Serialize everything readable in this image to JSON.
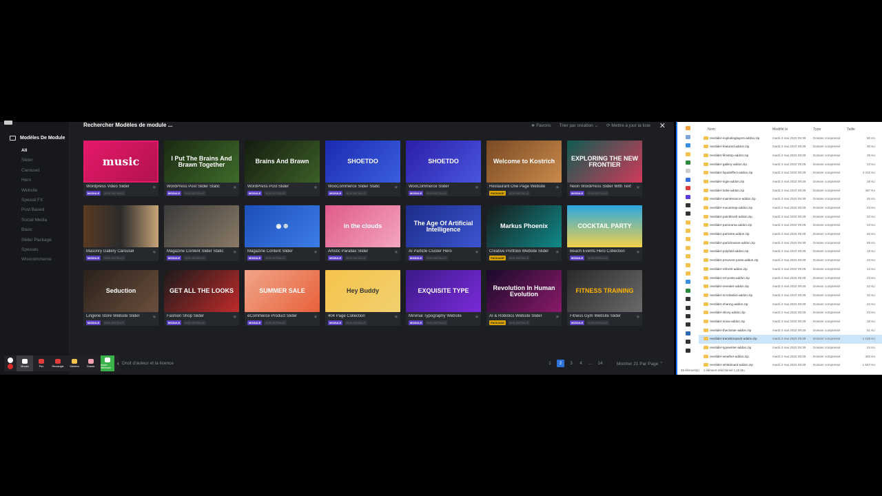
{
  "app": {
    "sidebar_title": "Modèles De Module",
    "categories": [
      "All",
      "Slider",
      "Carousel",
      "Hero",
      "Website",
      "Special FX",
      "Post Based",
      "Social Media",
      "Basic",
      "Slider Package",
      "Specials",
      "Woocommerce"
    ],
    "active_category": "All",
    "search_title": "Rechercher Modèles de module ...",
    "actions": {
      "favorites": "★ Favoris",
      "sort": "Trier par création ⌄",
      "update": "⟳ Mettre à jour la liste"
    },
    "close": "✕",
    "tags": {
      "module": "MODULE",
      "package": "PACKAGE",
      "not_installed": "NON INSTALLÉ"
    },
    "cards": [
      {
        "name": "Wordpress Video Slider",
        "thumb": "music",
        "bg": "linear-gradient(135deg,#e6196a,#b01250)",
        "fg": "#fff",
        "tag": "module"
      },
      {
        "name": "WordPress Post Slider Static",
        "thumb": "I Put The Brains And Brawn Together",
        "bg": "linear-gradient(135deg,#1a2a12,#3f6b2a)",
        "fg": "#fff",
        "tag": "module"
      },
      {
        "name": "WordPress Post Slider",
        "thumb": "Brains And Brawn",
        "bg": "linear-gradient(135deg,#141c10,#3c5f27)",
        "fg": "#fff",
        "tag": "module"
      },
      {
        "name": "WooCommerce Slider Static",
        "thumb": "SHOETDO",
        "bg": "linear-gradient(135deg,#1b2bb0,#3b5ee0)",
        "fg": "#fff",
        "tag": "module"
      },
      {
        "name": "WooCommerce Slider",
        "thumb": "SHOETDO",
        "bg": "linear-gradient(135deg,#2a1fa8,#4a55e0)",
        "fg": "#fff",
        "tag": "module"
      },
      {
        "name": "Restaurant One Page Website",
        "thumb": "Welcome to Kostrich",
        "bg": "linear-gradient(135deg,#7a4a25,#c98a4a)",
        "fg": "#fff",
        "tag": "package"
      },
      {
        "name": "Neon WordPress Slider With Text",
        "thumb": "EXPLORING THE NEW FRONTIER",
        "bg": "linear-gradient(135deg,#0f5c52,#d13a5a)",
        "fg": "#fff",
        "tag": "module"
      },
      {
        "name": "Masonry Gallery Carousel",
        "thumb": "",
        "bg": "linear-gradient(90deg,#5a3a22,#2b2b2b,#c8a478)",
        "fg": "#fff",
        "tag": "module"
      },
      {
        "name": "Magazine Content Slider Static",
        "thumb": "",
        "bg": "linear-gradient(135deg,#3a3a3a,#8a7a66)",
        "fg": "#fff",
        "tag": "module"
      },
      {
        "name": "Magazine Content Slider",
        "thumb": "◉  ⊕",
        "bg": "linear-gradient(135deg,#1d4fb8,#3d7de8)",
        "fg": "#fff",
        "tag": "module"
      },
      {
        "name": "Artistic Parallax Slider",
        "thumb": "in the clouds",
        "bg": "linear-gradient(135deg,#e05a8a,#f4a6c0)",
        "fg": "#fff",
        "tag": "module"
      },
      {
        "name": "AI Particle Cluster Hero",
        "thumb": "The Age Of Artificial Intelligence",
        "bg": "linear-gradient(135deg,#1d2c8a,#3b55d0)",
        "fg": "#fff",
        "tag": "module"
      },
      {
        "name": "Creative Portfolio Website Slider",
        "thumb": "Markus Phoenix",
        "bg": "linear-gradient(135deg,#1a1a1a,#0e8a8a)",
        "fg": "#fff",
        "tag": "package"
      },
      {
        "name": "Beach Events Hero Collection",
        "thumb": "COCKTAIL PARTY",
        "bg": "linear-gradient(180deg,#2aa7e0,#f2d24a)",
        "fg": "#fff",
        "tag": "module"
      },
      {
        "name": "Lingerie Store Website Slider",
        "thumb": "Seduction",
        "bg": "linear-gradient(135deg,#2a211b,#6b4f3d)",
        "fg": "#fff",
        "tag": "module"
      },
      {
        "name": "Fashion Shop Slider",
        "thumb": "GET ALL THE LOOKS",
        "bg": "linear-gradient(135deg,#1b1b1b,#c02a2a)",
        "fg": "#fff",
        "tag": "module"
      },
      {
        "name": "eCommerce Product Slider",
        "thumb": "SUMMER SALE",
        "bg": "linear-gradient(135deg,#f0a58a,#e8613a)",
        "fg": "#fff",
        "tag": "module"
      },
      {
        "name": "404 Page Collection",
        "thumb": "Hey Buddy",
        "bg": "linear-gradient(135deg,#f4c34c,#f2d06e)",
        "fg": "#333",
        "tag": "module"
      },
      {
        "name": "Minimal Typography Website",
        "thumb": "EXQUISITE TYPE",
        "bg": "linear-gradient(135deg,#3b1a8a,#7a2ad8)",
        "fg": "#fff",
        "tag": "module"
      },
      {
        "name": "AI & Robotics Website Slider",
        "thumb": "Revolution In Human Evolution",
        "bg": "linear-gradient(135deg,#1a0a2a,#8a1a6a)",
        "fg": "#fff",
        "tag": "package"
      },
      {
        "name": "Fitness Gym Website Slider",
        "thumb": "FITNESS TRAINING",
        "bg": "linear-gradient(135deg,#2a2a2a,#6a6a6a)",
        "fg": "#ffb400",
        "tag": "module"
      }
    ],
    "footer": {
      "license": "Droit d'auteur et la licence",
      "pages": [
        "1",
        "2",
        "3",
        "4",
        "...",
        "14"
      ],
      "current_page": "2",
      "per_page": "Montrer 21 Par Page ⌃"
    }
  },
  "recorder": {
    "tools": [
      "Mouse",
      "Pen",
      "Rectangle",
      "Stickers",
      "Eraser",
      "Insert Webcam"
    ],
    "toggle": "‹"
  },
  "explorer": {
    "columns": {
      "name": "Nom",
      "modified": "Modifié le",
      "type": "Type",
      "size": "Taille"
    },
    "rows": [
      {
        "name": "revslider-explodinglayers-addon.zip",
        "date": "mardi 2 mai 2023 09:39",
        "type": "Dossier compressé",
        "size": "50 Ko"
      },
      {
        "name": "revslider-featured-addon.zip",
        "date": "mardi 2 mai 2023 09:39",
        "type": "Dossier compressé",
        "size": "30 Ko"
      },
      {
        "name": "revslider-filmstrip-addon.zip",
        "date": "mardi 2 mai 2023 09:39",
        "type": "Dossier compressé",
        "size": "29 Ko"
      },
      {
        "name": "revslider-gallery-addon.zip",
        "date": "mardi 2 mai 2023 09:39",
        "type": "Dossier compressé",
        "size": "23 Ko"
      },
      {
        "name": "revslider-liquideffect-addon.zip",
        "date": "mardi 2 mai 2023 09:39",
        "type": "Dossier compressé",
        "size": "4 315 Ko"
      },
      {
        "name": "revslider-login-addon.zip",
        "date": "mardi 2 mai 2023 09:39",
        "type": "Dossier compressé",
        "size": "28 Ko"
      },
      {
        "name": "revslider-lottie-addon.zip",
        "date": "mardi 2 mai 2023 09:39",
        "type": "Dossier compressé",
        "size": "457 Ko"
      },
      {
        "name": "revslider-maintenance-addon.zip",
        "date": "mardi 2 mai 2023 09:39",
        "type": "Dossier compressé",
        "size": "26 Ko"
      },
      {
        "name": "revslider-mousetrap-addon.zip",
        "date": "mardi 2 mai 2023 09:39",
        "type": "Dossier compressé",
        "size": "23 Ko"
      },
      {
        "name": "revslider-paintbrush-addon.zip",
        "date": "mardi 2 mai 2023 09:39",
        "type": "Dossier compressé",
        "size": "22 Ko"
      },
      {
        "name": "revslider-panorama-addon.zip",
        "date": "mardi 2 mai 2023 09:39",
        "type": "Dossier compressé",
        "size": "23 Ko"
      },
      {
        "name": "revslider-particles-addon.zip",
        "date": "mardi 2 mai 2023 09:39",
        "type": "Dossier compressé",
        "size": "50 Ko"
      },
      {
        "name": "revslider-particlewave-addon.zip",
        "date": "mardi 2 mai 2023 09:39",
        "type": "Dossier compressé",
        "size": "59 Ko"
      },
      {
        "name": "revslider-polyfold-addon.zip",
        "date": "mardi 2 mai 2023 09:39",
        "type": "Dossier compressé",
        "size": "19 Ko"
      },
      {
        "name": "revslider-prevnext-posts-addon.zip",
        "date": "mardi 2 mai 2023 09:39",
        "type": "Dossier compressé",
        "size": "23 Ko"
      },
      {
        "name": "revslider-refresh-addon.zip",
        "date": "mardi 2 mai 2023 09:39",
        "type": "Dossier compressé",
        "size": "13 Ko"
      },
      {
        "name": "revslider-rel-posts-addon.zip",
        "date": "mardi 2 mai 2023 09:39",
        "type": "Dossier compressé",
        "size": "23 Ko"
      },
      {
        "name": "revslider-revealer-addon.zip",
        "date": "mardi 2 mai 2023 09:39",
        "type": "Dossier compressé",
        "size": "24 Ko"
      },
      {
        "name": "revslider-scrollvideo-addon.zip",
        "date": "mardi 2 mai 2023 09:39",
        "type": "Dossier compressé",
        "size": "32 Ko"
      },
      {
        "name": "revslider-sharing-addon.zip",
        "date": "mardi 2 mai 2023 09:39",
        "type": "Dossier compressé",
        "size": "22 Ko"
      },
      {
        "name": "revslider-slicey-addon.zip",
        "date": "mardi 2 mai 2023 09:39",
        "type": "Dossier compressé",
        "size": "23 Ko"
      },
      {
        "name": "revslider-snow-addon.zip",
        "date": "mardi 2 mai 2023 09:39",
        "type": "Dossier compressé",
        "size": "16 Ko"
      },
      {
        "name": "revslider-thecluster-addon.zip",
        "date": "mardi 2 mai 2023 09:39",
        "type": "Dossier compressé",
        "size": "51 Ko"
      },
      {
        "name": "revslider-transitionpack-addon.zip",
        "date": "mardi 2 mai 2023 09:39",
        "type": "Dossier compressé",
        "size": "1 228 Ko",
        "selected": true
      },
      {
        "name": "revslider-typewriter-addon.zip",
        "date": "mardi 2 mai 2023 09:39",
        "type": "Dossier compressé",
        "size": "24 Ko"
      },
      {
        "name": "revslider-weather-addon.zip",
        "date": "mardi 2 mai 2023 09:39",
        "type": "Dossier compressé",
        "size": "402 Ko"
      },
      {
        "name": "revslider-whiteboard-addon.zip",
        "date": "mardi 2 mai 2023 09:39",
        "type": "Dossier compressé",
        "size": "1 557 Ko"
      }
    ],
    "status": {
      "count": "35 élément(s)",
      "selection": "1 élément sélectionné  1,19 Mo"
    },
    "nav_colors": [
      "#f2a43a",
      "#7aa7d8",
      "#3a8ee0",
      "#f2c14e",
      "#2b8a3e",
      "#cccccc",
      "#3a6ee0",
      "#e03a3a",
      "#5a3ae0",
      "#333333",
      "#333333",
      "#f2c14e",
      "#f2c14e",
      "#f2c14e",
      "#f2c14e",
      "#f2c14e",
      "#f2c14e",
      "#f2c14e",
      "#3a8ee0",
      "#2b8a3e",
      "#333333",
      "#333333",
      "#333333",
      "#333333",
      "#2b6ab0",
      "#333333",
      "#333333"
    ]
  }
}
